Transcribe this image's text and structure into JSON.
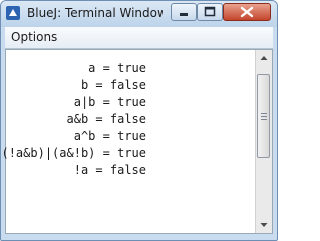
{
  "window": {
    "title": "BlueJ: Terminal Window",
    "title_visible": "BlueJ: Terminal Window..."
  },
  "menu": {
    "options_label": "Options"
  },
  "terminal": {
    "lines": [
      {
        "expr": "a",
        "value": "true"
      },
      {
        "expr": "b",
        "value": "false"
      },
      {
        "expr": "a|b",
        "value": "true"
      },
      {
        "expr": "a&b",
        "value": "false"
      },
      {
        "expr": "a^b",
        "value": "true"
      },
      {
        "expr": "(!a&b)|(a&!b)",
        "value": "true"
      },
      {
        "expr": "!a",
        "value": "false"
      }
    ]
  },
  "colors": {
    "titlebar": "#c9dcef",
    "close_button": "#c4442b"
  },
  "icons": {
    "app": "bluej-icon",
    "minimize": "minimize-icon",
    "maximize": "maximize-icon",
    "close": "close-icon"
  }
}
